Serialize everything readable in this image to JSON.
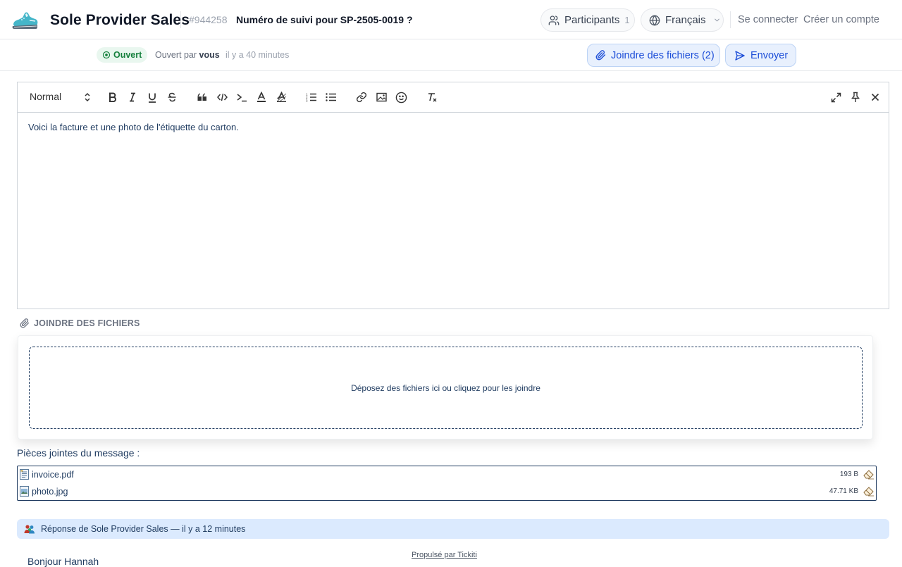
{
  "header": {
    "brand": "Sole Provider Sales",
    "ticket_id": "#944258",
    "ticket_title": "Numéro de suivi pour SP-2505-0019 ?",
    "participants_label": "Participants",
    "participants_count": "1",
    "language": "Français",
    "login": "Se connecter",
    "signup": "Créer un compte"
  },
  "status": {
    "badge": "Ouvert",
    "opened_by_prefix": "Ouvert par",
    "opened_by_user": "vous",
    "opened_time": "il y a 40 minutes",
    "attach_button": "Joindre des fichiers (2)",
    "send_button": "Envoyer"
  },
  "editor": {
    "format_select": "Normal",
    "body": "Voici la facture et une photo de l'étiquette du carton."
  },
  "attachments": {
    "heading": "JOINDRE DES FICHIERS",
    "dropzone_text": "Déposez des fichiers ici ou cliquez pour les joindre",
    "list_title": "Pièces jointes du message :",
    "files": [
      {
        "name": "invoice.pdf",
        "size": "193 B",
        "icon": "document-icon"
      },
      {
        "name": "photo.jpg",
        "size": "47.71 KB",
        "icon": "image-file-icon"
      }
    ]
  },
  "reply": {
    "header": "Réponse de Sole Provider Sales — il y a 12 minutes",
    "body_preview": "Bonjour Hannah"
  },
  "footer": {
    "powered": "Propulsé par Tickiti"
  },
  "colors": {
    "accent": "#1d4ed8",
    "status_open": "#15803d",
    "text_dark_blue": "#1e3a5f"
  }
}
